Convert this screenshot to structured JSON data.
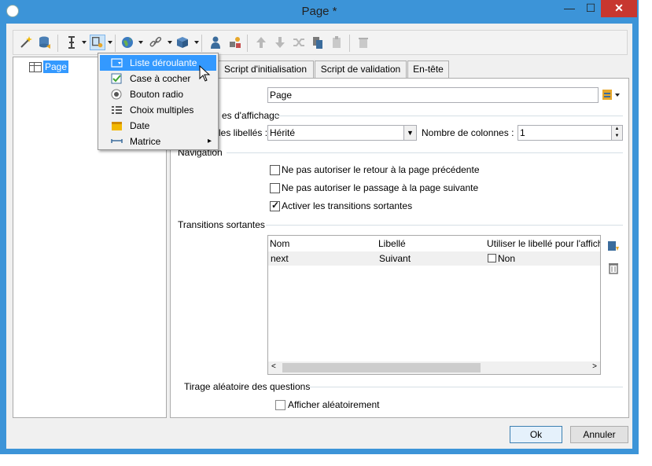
{
  "window": {
    "title": "Page *",
    "minimize": "—",
    "maximize": "☐",
    "close": "✕"
  },
  "toolbar": {
    "icons": [
      "magic-wand-icon",
      "database-icon",
      "text-cursor-icon",
      "field-insert-icon",
      "globe-icon",
      "link-icon",
      "package-icon",
      "person-icon",
      "shapes-icon",
      "arrow-up-icon",
      "arrow-down-icon",
      "shuffle-icon",
      "copy-icon",
      "paste-icon",
      "delete-icon"
    ]
  },
  "tree": {
    "root_label": "Page"
  },
  "menu": {
    "items": [
      {
        "label": "Liste déroulante",
        "icon": "dropdown-list-icon",
        "highlighted": true
      },
      {
        "label": "Case à cocher",
        "icon": "checkbox-icon"
      },
      {
        "label": "Bouton radio",
        "icon": "radio-button-icon"
      },
      {
        "label": "Choix multiples",
        "icon": "multiple-choice-icon"
      },
      {
        "label": "Date",
        "icon": "date-icon"
      },
      {
        "label": "Matrice",
        "icon": "matrix-icon",
        "submenu_arrow": "▸"
      }
    ]
  },
  "tabs": [
    {
      "label": "Script d'initialisation"
    },
    {
      "label": "Script de validation"
    },
    {
      "label": "En-tête"
    }
  ],
  "form": {
    "label_value": "Page",
    "section_display": "es d'affichage",
    "position_label": "les libellés :",
    "position_value": "Hérité",
    "columns_label": "Nombre de colonnes :",
    "columns_value": "1",
    "section_navigation": "Navigation",
    "nav_checks": [
      {
        "label": "Ne pas autoriser le retour à la page précédente",
        "checked": false
      },
      {
        "label": "Ne pas autoriser le passage à la page suivante",
        "checked": false
      },
      {
        "label": "Activer les transitions sortantes",
        "checked": true
      }
    ],
    "section_transitions": "Transitions sortantes",
    "grid": {
      "headers": [
        "Nom",
        "Libellé",
        "Utiliser le libellé pour l'affich"
      ],
      "rows": [
        {
          "name": "next",
          "label": "Suivant",
          "use_label": "Non"
        }
      ]
    },
    "section_random": "Tirage aléatoire des questions",
    "random_check": {
      "label": "Afficher aléatoirement",
      "checked": false
    }
  },
  "buttons": {
    "ok": "Ok",
    "cancel": "Annuler"
  },
  "colors": {
    "titlebar": "#3c94d8",
    "close": "#c7372f",
    "highlight": "#3399ff"
  }
}
